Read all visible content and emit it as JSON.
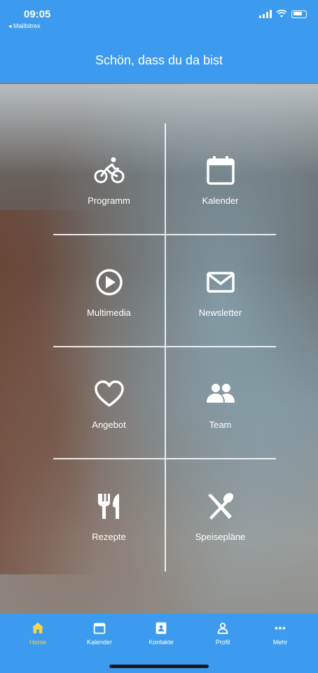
{
  "status": {
    "time": "09:05",
    "back_label": "◂ Mailbitrex"
  },
  "header": {
    "title": "Schön, dass du da bist"
  },
  "menu": {
    "items": [
      {
        "label": "Programm",
        "icon": "bicycle-icon"
      },
      {
        "label": "Kalender",
        "icon": "calendar-icon"
      },
      {
        "label": "Multimedia",
        "icon": "play-circle-icon"
      },
      {
        "label": "Newsletter",
        "icon": "mail-icon"
      },
      {
        "label": "Angebot",
        "icon": "heart-icon"
      },
      {
        "label": "Team",
        "icon": "people-icon"
      },
      {
        "label": "Rezepte",
        "icon": "cutlery-icon"
      },
      {
        "label": "Speisepläne",
        "icon": "spoon-knife-cross-icon"
      }
    ]
  },
  "tabbar": {
    "tabs": [
      {
        "label": "Home",
        "icon": "home-icon",
        "active": true
      },
      {
        "label": "Kalender",
        "icon": "calendar-icon",
        "active": false
      },
      {
        "label": "Kontakte",
        "icon": "contacts-icon",
        "active": false
      },
      {
        "label": "Profil",
        "icon": "profile-icon",
        "active": false
      },
      {
        "label": "Mehr",
        "icon": "more-icon",
        "active": false
      }
    ]
  },
  "colors": {
    "primary": "#3c9bee",
    "active_tab": "#f6d54a",
    "text": "#ffffff"
  }
}
